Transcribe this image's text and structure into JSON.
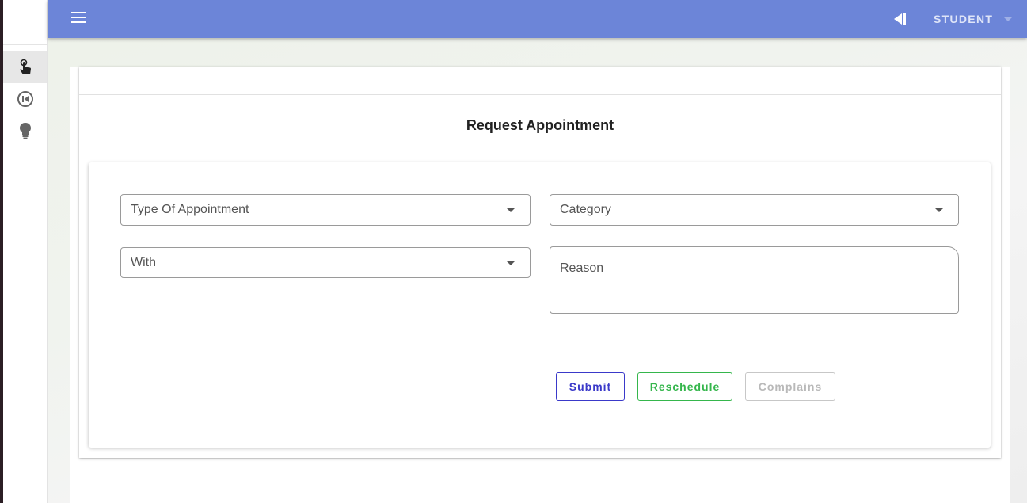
{
  "header": {
    "user_label": "STUDENT"
  },
  "sidebar": {
    "items": [
      {
        "icon": "touch-hand-icon",
        "active": true
      },
      {
        "icon": "skip-previous-circle-icon",
        "active": false
      },
      {
        "icon": "lightbulb-icon",
        "active": false
      }
    ]
  },
  "page": {
    "title": "Request Appointment"
  },
  "form": {
    "type_label": "Type Of Appointment",
    "category_label": "Category",
    "with_label": "With",
    "reason_label": "Reason"
  },
  "buttons": {
    "submit": "Submit",
    "reschedule": "Reschedule",
    "complains": "Complains"
  },
  "colors": {
    "topbar": "#6c85d8",
    "submit": "#3a39c9",
    "reschedule": "#35b64c",
    "complains_disabled": "#b9b9b9"
  }
}
